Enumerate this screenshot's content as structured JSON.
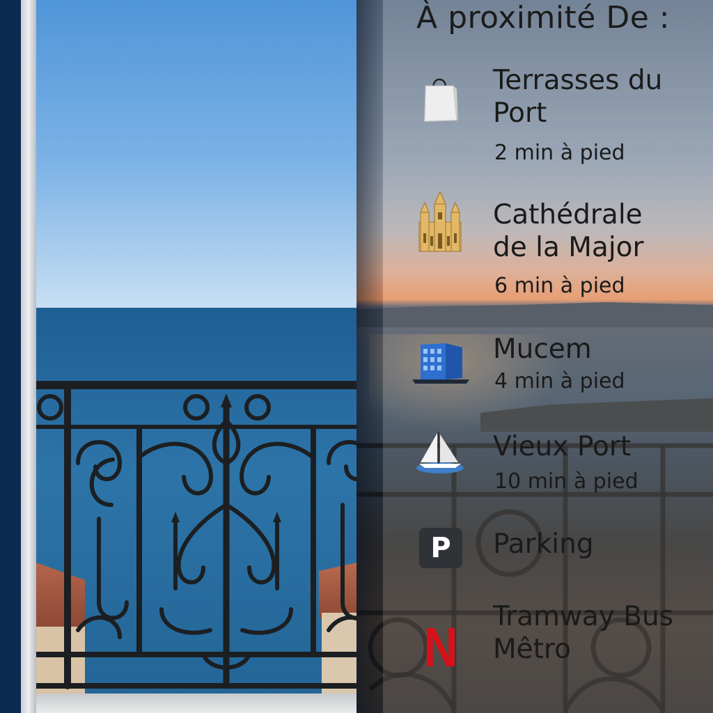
{
  "title": "À proximité De :",
  "places": [
    {
      "icon": "shopping-bag-icon",
      "name_line1": "Terrasses du",
      "name_line2": "Port",
      "walk": "2 min à pied"
    },
    {
      "icon": "cathedral-icon",
      "name_line1": "Cathédrale",
      "name_line2": "de la Major",
      "walk": "6 min à pied"
    },
    {
      "icon": "museum-building-icon",
      "name_line1": "Mucem",
      "walk": "4 min à pied"
    },
    {
      "icon": "sailboat-icon",
      "name_line1": "Vieux Port",
      "walk": "10 min à pied"
    },
    {
      "icon": "parking-icon",
      "name_line1": "Parking",
      "badge": "P"
    },
    {
      "icon": "transit-n-icon",
      "name_line1": "Tramway Bus",
      "name_line2": "Mêtro",
      "badge": "N"
    }
  ],
  "colors": {
    "sky": "#4f95d9",
    "sea": "#2d74a8",
    "text": "#1a1a1a",
    "transit_red": "#d7101a",
    "parking_dark": "#2f3338"
  }
}
